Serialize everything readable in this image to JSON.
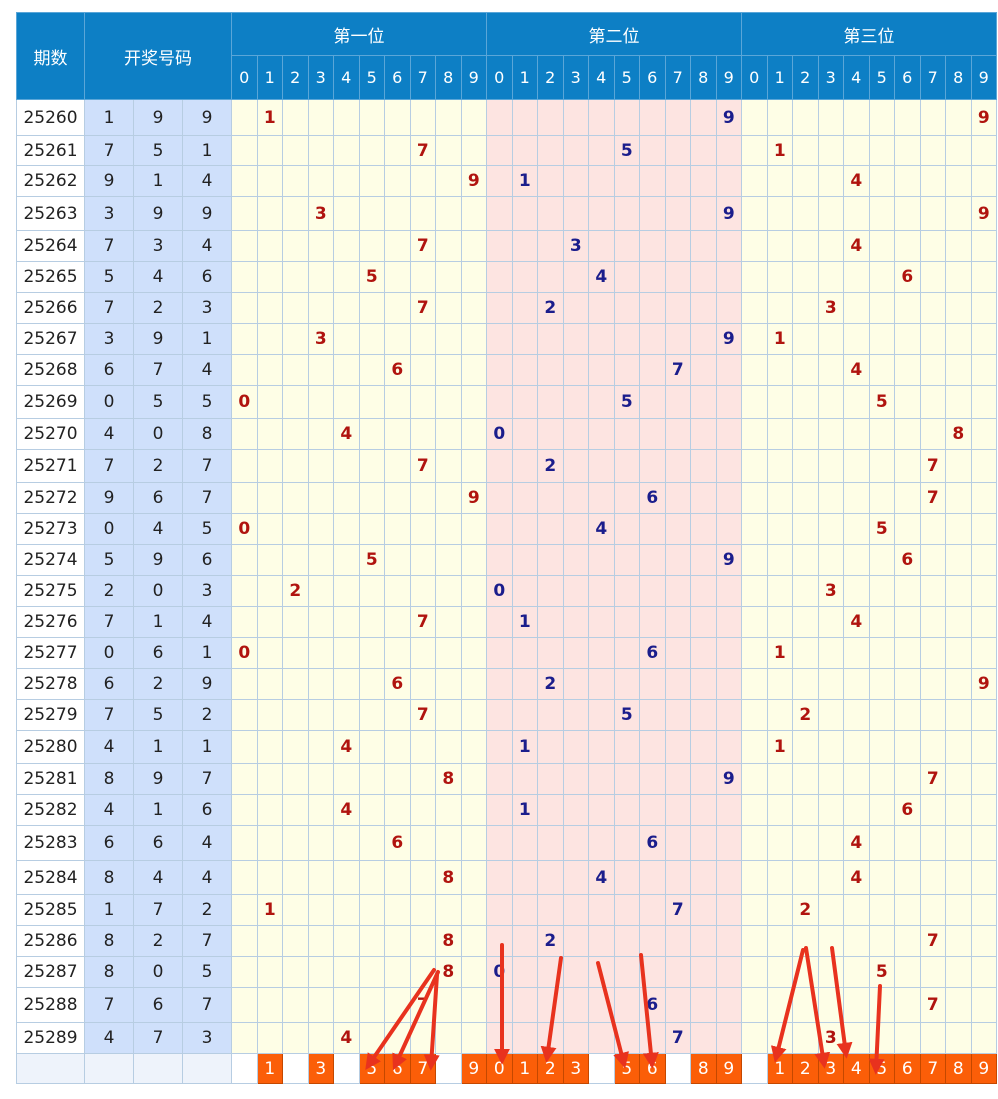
{
  "header": {
    "period_label": "期数",
    "numbers_label": "开奖号码",
    "positions": [
      "第一位",
      "第二位",
      "第三位"
    ],
    "digits": [
      "0",
      "1",
      "2",
      "3",
      "4",
      "5",
      "6",
      "7",
      "8",
      "9"
    ]
  },
  "rows": [
    {
      "period": "25260",
      "nums": [
        1,
        9,
        9
      ]
    },
    {
      "period": "25261",
      "nums": [
        7,
        5,
        1
      ]
    },
    {
      "period": "25262",
      "nums": [
        9,
        1,
        4
      ]
    },
    {
      "period": "25263",
      "nums": [
        3,
        9,
        9
      ]
    },
    {
      "period": "25264",
      "nums": [
        7,
        3,
        4
      ]
    },
    {
      "period": "25265",
      "nums": [
        5,
        4,
        6
      ]
    },
    {
      "period": "25266",
      "nums": [
        7,
        2,
        3
      ]
    },
    {
      "period": "25267",
      "nums": [
        3,
        9,
        1
      ]
    },
    {
      "period": "25268",
      "nums": [
        6,
        7,
        4
      ]
    },
    {
      "period": "25269",
      "nums": [
        0,
        5,
        5
      ]
    },
    {
      "period": "25270",
      "nums": [
        4,
        0,
        8
      ]
    },
    {
      "period": "25271",
      "nums": [
        7,
        2,
        7
      ]
    },
    {
      "period": "25272",
      "nums": [
        9,
        6,
        7
      ]
    },
    {
      "period": "25273",
      "nums": [
        0,
        4,
        5
      ]
    },
    {
      "period": "25274",
      "nums": [
        5,
        9,
        6
      ]
    },
    {
      "period": "25275",
      "nums": [
        2,
        0,
        3
      ]
    },
    {
      "period": "25276",
      "nums": [
        7,
        1,
        4
      ]
    },
    {
      "period": "25277",
      "nums": [
        0,
        6,
        1
      ]
    },
    {
      "period": "25278",
      "nums": [
        6,
        2,
        9
      ]
    },
    {
      "period": "25279",
      "nums": [
        7,
        5,
        2
      ]
    },
    {
      "period": "25280",
      "nums": [
        4,
        1,
        1
      ]
    },
    {
      "period": "25281",
      "nums": [
        8,
        9,
        7
      ]
    },
    {
      "period": "25282",
      "nums": [
        4,
        1,
        6
      ]
    },
    {
      "period": "25283",
      "nums": [
        6,
        6,
        4
      ]
    },
    {
      "period": "25284",
      "nums": [
        8,
        4,
        4
      ]
    },
    {
      "period": "25285",
      "nums": [
        1,
        7,
        2
      ]
    },
    {
      "period": "25286",
      "nums": [
        8,
        2,
        7
      ]
    },
    {
      "period": "25287",
      "nums": [
        8,
        0,
        5
      ]
    },
    {
      "period": "25288",
      "nums": [
        7,
        6,
        7
      ]
    },
    {
      "period": "25289",
      "nums": [
        4,
        7,
        3
      ]
    }
  ],
  "footer_picks": [
    [
      "1",
      "3",
      "5",
      "6",
      "7",
      "9"
    ],
    [
      "0",
      "1",
      "2",
      "3",
      "5",
      "6",
      "8",
      "9"
    ],
    [
      "1",
      "2",
      "3",
      "4",
      "5",
      "6",
      "7",
      "8",
      "9"
    ]
  ],
  "colors": {
    "header_blue": "#0d7fc5",
    "winning_bg": "#cfe0fb",
    "pos1_bg": "#fefee6",
    "pos2_bg": "#fde4e1",
    "pos3_bg": "#fefee6",
    "pos1_digit": "#b0140f",
    "pos2_digit": "#1b1d8c",
    "pos3_digit": "#b0140f",
    "pick_bg": "#fb5e08",
    "arrow_red": "#e8321e"
  }
}
